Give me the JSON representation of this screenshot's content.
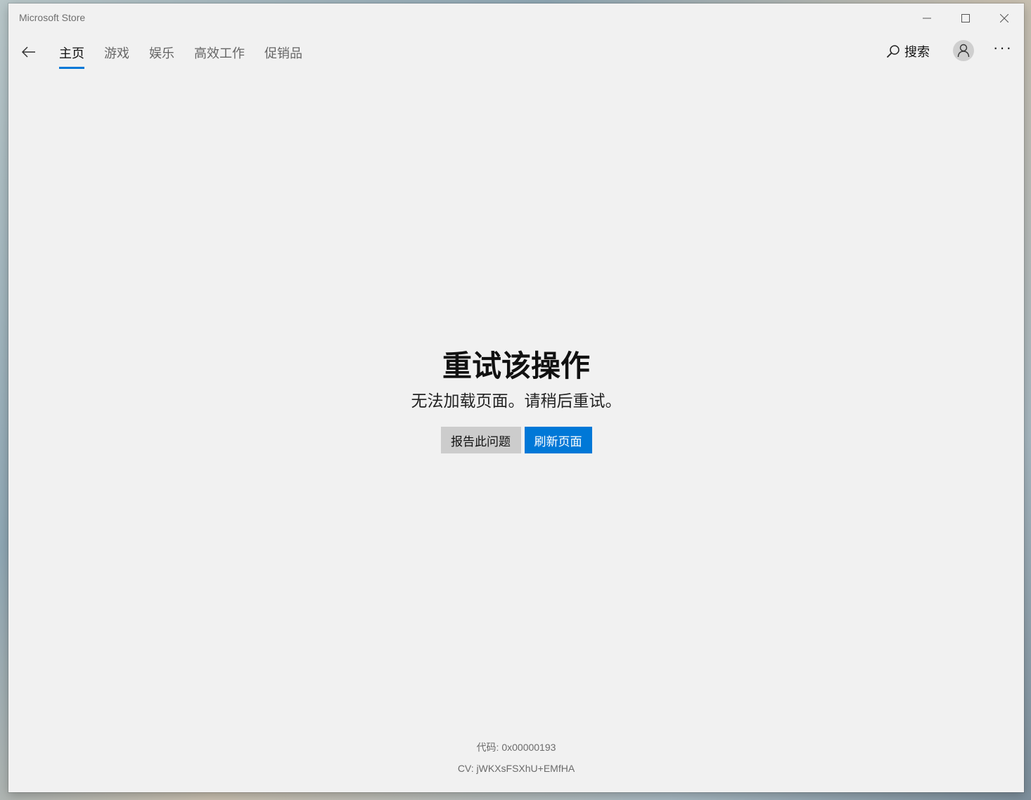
{
  "window": {
    "title": "Microsoft Store"
  },
  "nav": {
    "tabs": [
      {
        "label": "主页",
        "active": true
      },
      {
        "label": "游戏"
      },
      {
        "label": "娱乐"
      },
      {
        "label": "高效工作"
      },
      {
        "label": "促销品"
      }
    ],
    "search_label": "搜索"
  },
  "error": {
    "title": "重试该操作",
    "message": "无法加载页面。请稍后重试。",
    "report_button": "报告此问题",
    "refresh_button": "刷新页面"
  },
  "footer": {
    "code": "代码: 0x00000193",
    "cv": "CV: jWKXsFSXhU+EMfHA"
  },
  "colors": {
    "accent": "#0078d7",
    "background": "#f1f1f1",
    "secondary_button": "#cccccc"
  },
  "icons": {
    "back": "back-arrow-icon",
    "search": "search-icon",
    "account": "user-icon",
    "more": "more-icon"
  }
}
